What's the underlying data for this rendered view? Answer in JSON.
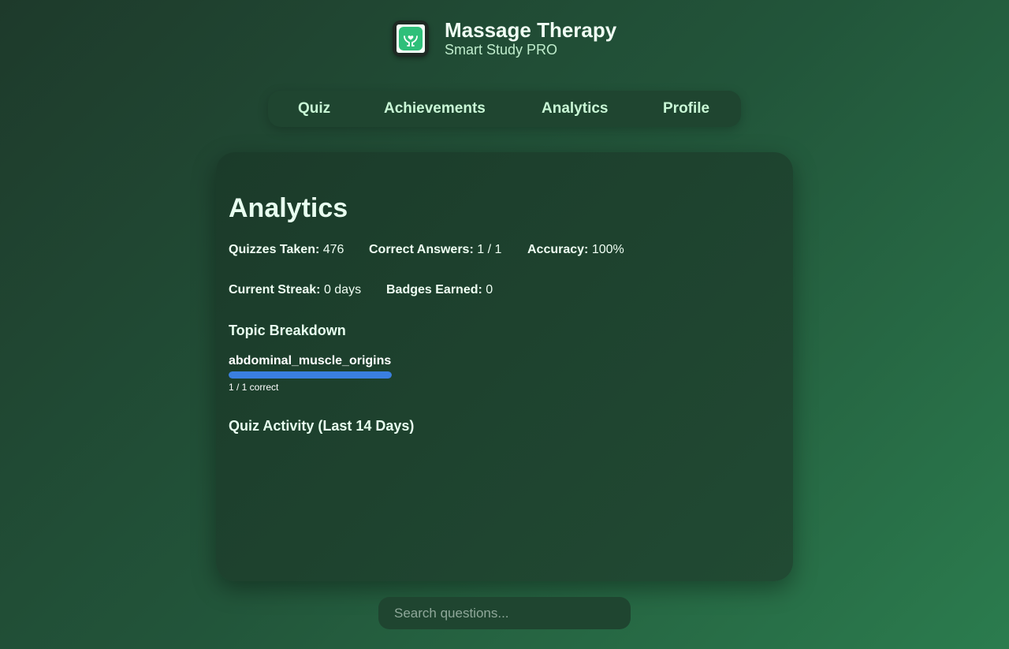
{
  "app": {
    "title": "Massage Therapy",
    "subtitle": "Smart Study PRO",
    "icon": "hands-heart-icon"
  },
  "nav": {
    "items": [
      {
        "label": "Quiz"
      },
      {
        "label": "Achievements"
      },
      {
        "label": "Analytics"
      },
      {
        "label": "Profile"
      }
    ]
  },
  "analytics": {
    "title": "Analytics",
    "stats": {
      "quizzes_taken_label": "Quizzes Taken:",
      "quizzes_taken_value": "476",
      "correct_answers_label": "Correct Answers:",
      "correct_answers_value": "1 / 1",
      "accuracy_label": "Accuracy:",
      "accuracy_value": "100%",
      "current_streak_label": "Current Streak:",
      "current_streak_value": "0 days",
      "badges_earned_label": "Badges Earned:",
      "badges_earned_value": "0"
    },
    "topic_breakdown": {
      "title": "Topic Breakdown",
      "topics": [
        {
          "name": "abdominal_muscle_origins",
          "detail": "1 / 1 correct",
          "progress": 1.0
        }
      ]
    },
    "activity": {
      "title": "Quiz Activity (Last 14 Days)"
    }
  },
  "search": {
    "placeholder": "Search questions..."
  },
  "colors": {
    "accent": "#3a7fe0",
    "background_start": "#1e3a2b",
    "background_end": "#2b7c4e"
  }
}
